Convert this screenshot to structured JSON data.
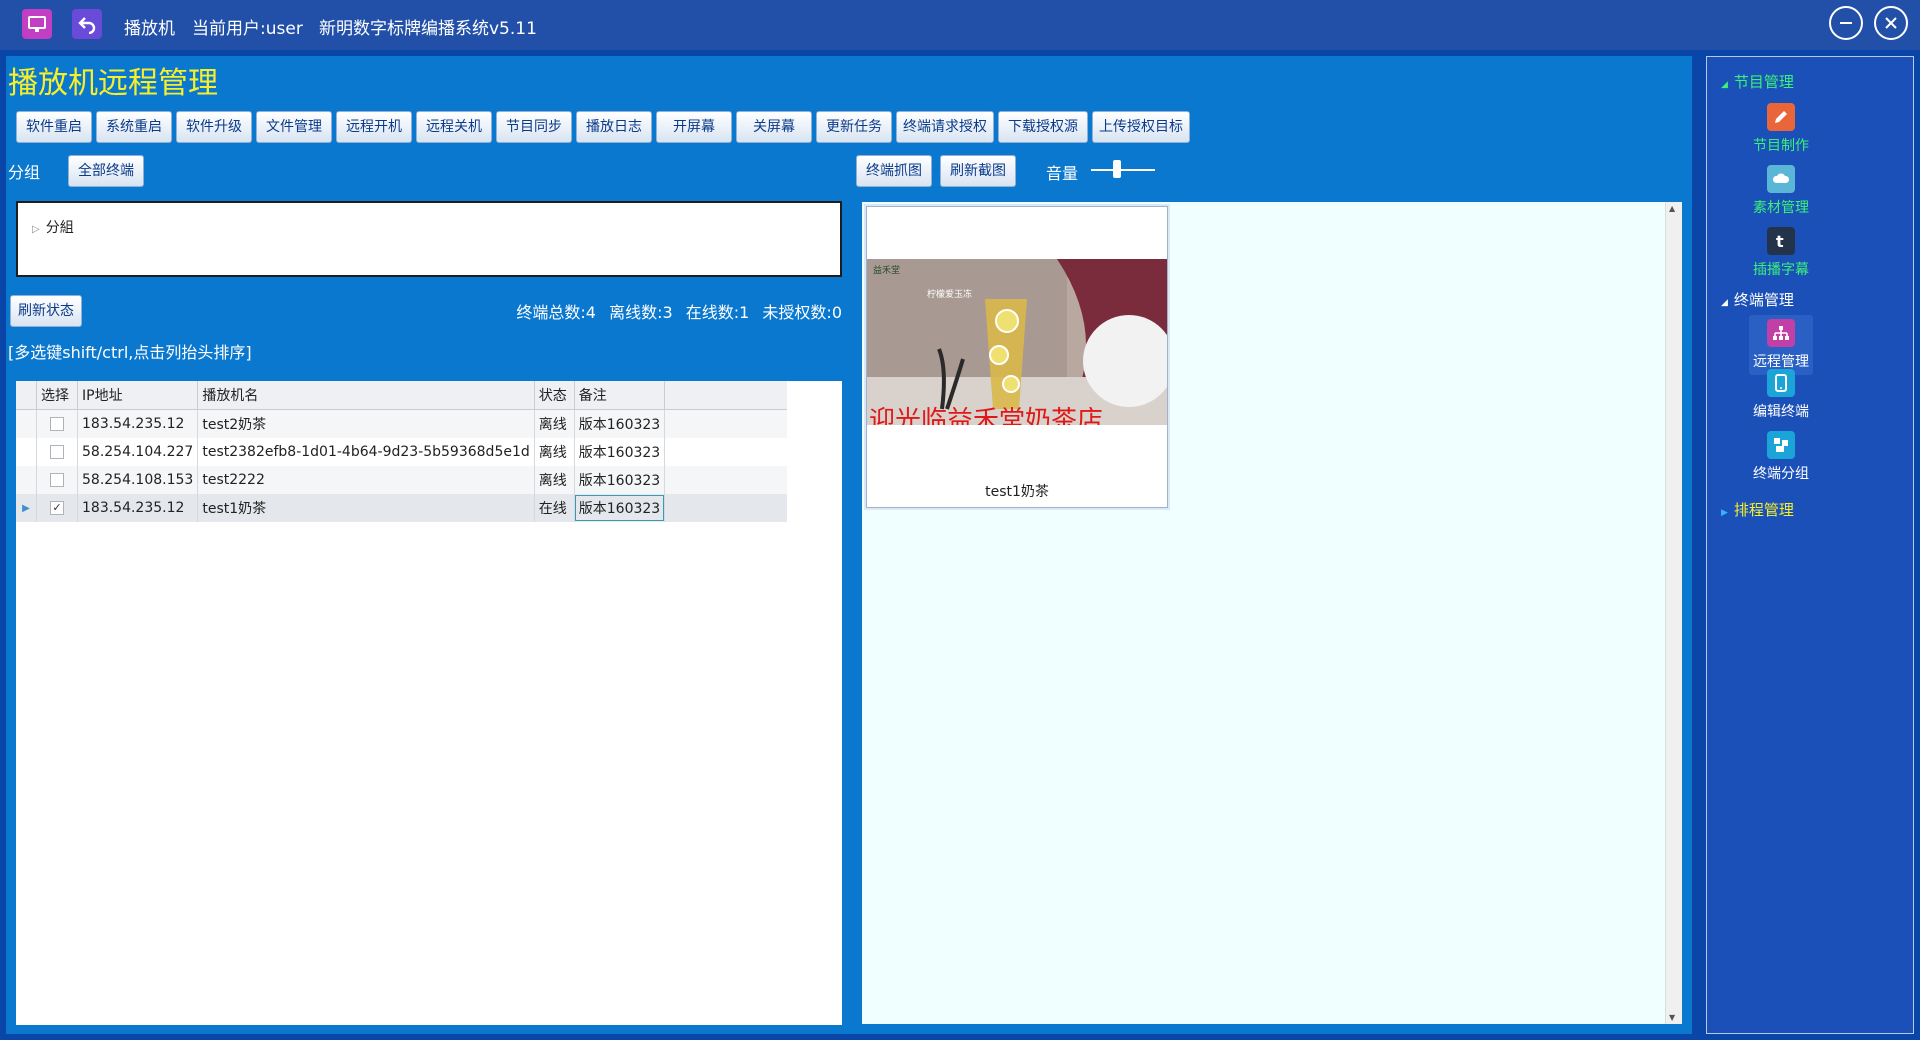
{
  "titlebar": {
    "app_name": "播放机",
    "current_user": "当前用户:user",
    "system_name": "新明数字标牌编播系统v5.11"
  },
  "page": {
    "title": "播放机远程管理"
  },
  "toolbar": [
    "软件重启",
    "系统重启",
    "软件升级",
    "文件管理",
    "远程开机",
    "远程关机",
    "节目同步",
    "播放日志",
    "开屏幕",
    "关屏幕",
    "更新任务",
    "终端请求授权",
    "下载授权源",
    "上传授权目标"
  ],
  "group": {
    "label": "分组",
    "all_button": "全部终端",
    "tree_node": "分組"
  },
  "status": {
    "refresh_button": "刷新状态",
    "total": "终端总数:4",
    "offline": "离线数:3",
    "online": "在线数:1",
    "unauthorized": "未授权数:0"
  },
  "hint": "[多选键shift/ctrl,点击列抬头排序]",
  "table": {
    "headers": [
      "选择",
      "IP地址",
      "播放机名",
      "状态",
      "备注"
    ],
    "rows": [
      {
        "checked": false,
        "ip": "183.54.235.12",
        "name": "test2奶茶",
        "status": "离线",
        "note": "版本160323"
      },
      {
        "checked": false,
        "ip": "58.254.104.227",
        "name": "test2382efb8-1d01-4b64-9d23-5b59368d5e1d",
        "status": "离线",
        "note": "版本160323"
      },
      {
        "checked": false,
        "ip": "58.254.108.153",
        "name": "test2222",
        "status": "离线",
        "note": "版本160323"
      },
      {
        "checked": true,
        "ip": "183.54.235.12",
        "name": "test1奶茶",
        "status": "在线",
        "note": "版本160323"
      }
    ]
  },
  "screenshot": {
    "capture_button": "终端抓图",
    "refresh_button": "刷新截图",
    "volume_label": "音量",
    "volume_level": 0.4,
    "thumb_caption": "test1奶茶",
    "thumb_product": "柠檬爱玉冻",
    "thumb_brand": "益禾堂",
    "thumb_banner": "迎光临益禾堂奶茶店"
  },
  "nav": {
    "section_program": "节目管理",
    "program_make": "节目制作",
    "material_manage": "素材管理",
    "subtitle": "插播字幕",
    "section_terminal": "终端管理",
    "remote_manage": "远程管理",
    "edit_terminal": "编辑终端",
    "terminal_group": "终端分组",
    "section_schedule": "排程管理"
  },
  "colors": {
    "title_yellow": "#f6ef2a",
    "panel_blue": "#0b78cf",
    "nav_blue": "#1a50b8",
    "nav_green": "#3cf07a",
    "nav_yellow": "#f6ef2a"
  }
}
